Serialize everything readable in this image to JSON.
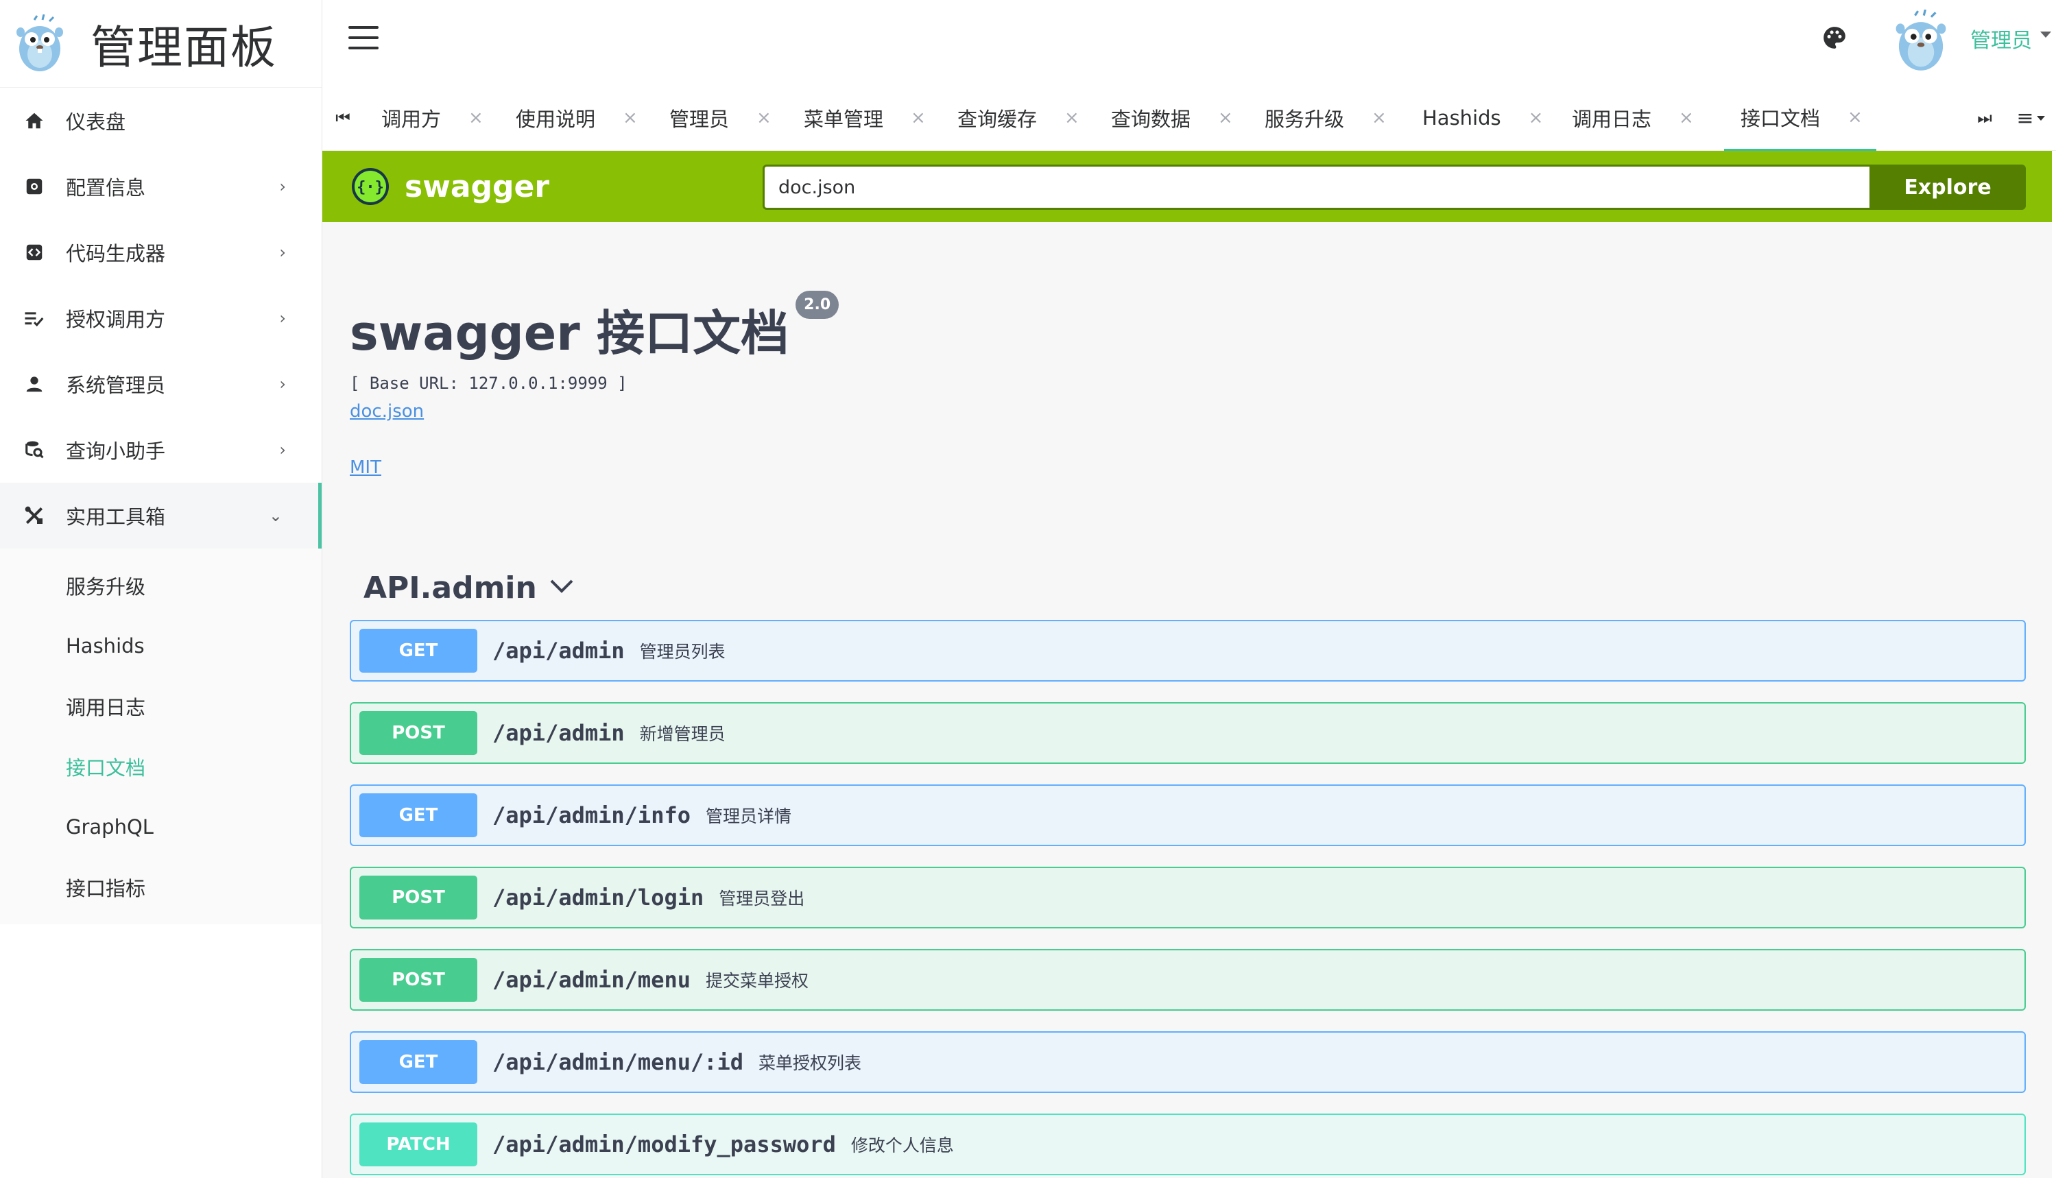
{
  "app": {
    "title": "管理面板"
  },
  "sidebar": {
    "items": [
      {
        "label": "仪表盘",
        "icon": "home-icon"
      },
      {
        "label": "配置信息",
        "icon": "settings-box-icon",
        "arrow": "›"
      },
      {
        "label": "代码生成器",
        "icon": "code-box-icon",
        "arrow": "›"
      },
      {
        "label": "授权调用方",
        "icon": "list-check-icon",
        "arrow": "›"
      },
      {
        "label": "系统管理员",
        "icon": "person-icon",
        "arrow": "›"
      },
      {
        "label": "查询小助手",
        "icon": "search-db-icon",
        "arrow": "›"
      },
      {
        "label": "实用工具箱",
        "icon": "tools-icon",
        "arrow": "⌄"
      }
    ],
    "submenu": [
      {
        "label": "服务升级"
      },
      {
        "label": "Hashids"
      },
      {
        "label": "调用日志"
      },
      {
        "label": "接口文档"
      },
      {
        "label": "GraphQL"
      },
      {
        "label": "接口指标"
      }
    ]
  },
  "header": {
    "user_name": "管理员"
  },
  "tabs": {
    "first": "⏮",
    "last": "⏭",
    "menu": "≡",
    "close": "×",
    "items": [
      {
        "label": "调用方"
      },
      {
        "label": "使用说明"
      },
      {
        "label": "管理员"
      },
      {
        "label": "菜单管理"
      },
      {
        "label": "查询缓存"
      },
      {
        "label": "查询数据"
      },
      {
        "label": "服务升级"
      },
      {
        "label": "Hashids"
      },
      {
        "label": "调用日志"
      },
      {
        "label": "接口文档"
      }
    ]
  },
  "swagger": {
    "logo_text": "swagger",
    "url_value": "doc.json",
    "explore_label": "Explore",
    "title": "swagger 接口文档",
    "version": "2.0",
    "base_url": "[ Base URL: 127.0.0.1:9999 ]",
    "spec_link": "doc.json",
    "license_link": "MIT",
    "section": "API.admin",
    "operations": [
      {
        "method": "GET",
        "path": "/api/admin",
        "summary": "管理员列表"
      },
      {
        "method": "POST",
        "path": "/api/admin",
        "summary": "新增管理员"
      },
      {
        "method": "GET",
        "path": "/api/admin/info",
        "summary": "管理员详情"
      },
      {
        "method": "POST",
        "path": "/api/admin/login",
        "summary": "管理员登出"
      },
      {
        "method": "POST",
        "path": "/api/admin/menu",
        "summary": "提交菜单授权"
      },
      {
        "method": "GET",
        "path": "/api/admin/menu/:id",
        "summary": "菜单授权列表"
      },
      {
        "method": "PATCH",
        "path": "/api/admin/modify_password",
        "summary": "修改个人信息"
      }
    ]
  },
  "colors": {
    "accent": "#3cbf9b",
    "swagger_green": "#89bf04",
    "get": "#61affe",
    "post": "#49cc90",
    "patch": "#50e3c2"
  }
}
